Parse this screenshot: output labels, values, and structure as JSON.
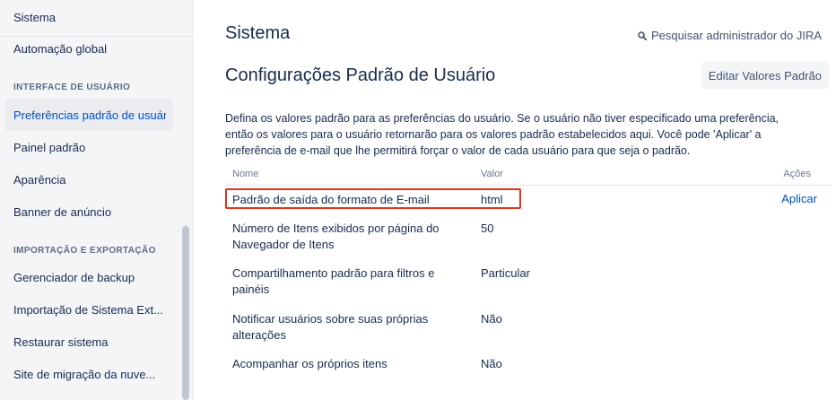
{
  "sidebar": {
    "top_label": "Sistema",
    "items_before": [
      {
        "label": "Automação global"
      }
    ],
    "section_ui": "INTERFACE DE USUÁRIO",
    "active_item": "Preferências padrão de usuário",
    "ui_items": [
      {
        "label": "Painel padrão"
      },
      {
        "label": "Aparência"
      },
      {
        "label": "Banner de anúncio"
      }
    ],
    "section_import": "IMPORTAÇÃO E EXPORTAÇÃO",
    "import_items": [
      {
        "label": "Gerenciador de backup"
      },
      {
        "label": "Importação de Sistema Ext..."
      },
      {
        "label": "Restaurar sistema"
      },
      {
        "label": "Site de migração da nuve..."
      }
    ]
  },
  "header": {
    "title": "Sistema",
    "search_link": "Pesquisar administrador do JIRA"
  },
  "section": {
    "title": "Configurações Padrão de Usuário",
    "edit_button": "Editar Valores Padrão",
    "description": "Defina os valores padrão para as preferências do usuário. Se o usuário não tiver especificado uma preferência, então os valores para o usuário retornarão para os valores padrão estabelecidos aqui. Você pode 'Aplicar' a preferência de e-mail que lhe permitirá forçar o valor de cada usuário para que seja o padrão."
  },
  "table": {
    "headers": {
      "name": "Nome",
      "value": "Valor",
      "actions": "Ações"
    },
    "rows": [
      {
        "name": "Padrão de saída do formato de E-mail",
        "value": "html",
        "action": "Aplicar"
      },
      {
        "name": "Número de Itens exibidos por página do Navegador de Itens",
        "value": "50"
      },
      {
        "name": "Compartilhamento padrão para filtros e painéis",
        "value": "Particular"
      },
      {
        "name": "Notificar usuários sobre suas próprias alterações",
        "value": "Não"
      },
      {
        "name": "Acompanhar os próprios itens",
        "value": "Não"
      }
    ]
  },
  "colors": {
    "highlight": "#e0341b",
    "link": "#0052cc",
    "sidebar_bg": "#f4f5f7"
  }
}
